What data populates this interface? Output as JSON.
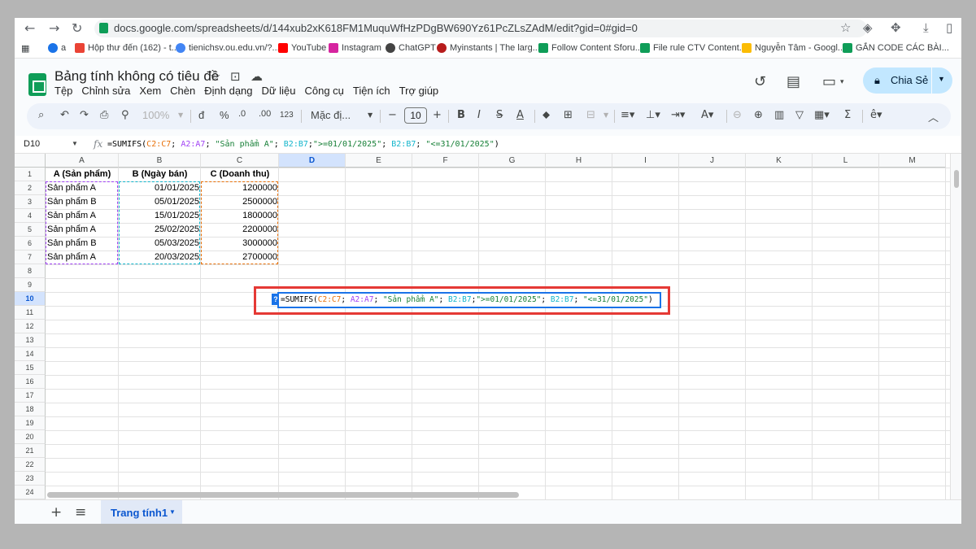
{
  "browser": {
    "url": "docs.google.com/spreadsheets/d/144xub2xK618FM1MuquWfHzPDgBW690Yz61PcZLsZAdM/edit?gid=0#gid=0",
    "bookmarks": [
      {
        "label": "a",
        "color": "#1a73e8"
      },
      {
        "label": "Hộp thư đến (162) - t...",
        "color": "#ea4335"
      },
      {
        "label": "tienichsv.ou.edu.vn/?...",
        "color": "#4285f4"
      },
      {
        "label": "YouTube",
        "color": "#ff0000"
      },
      {
        "label": "Instagram",
        "color": "#d6249f"
      },
      {
        "label": "ChatGPT",
        "color": "#444444"
      },
      {
        "label": "Myinstants | The larg...",
        "color": "#b71c1c"
      },
      {
        "label": "Follow Content Sforu...",
        "color": "#0f9d58"
      },
      {
        "label": "File rule CTV Content...",
        "color": "#0f9d58"
      },
      {
        "label": "Nguyễn Tâm - Googl...",
        "color": "#fbbc04"
      },
      {
        "label": "GẮN CODE CÁC BÀI...",
        "color": "#0f9d58"
      }
    ]
  },
  "doc": {
    "title": "Bảng tính không có tiêu đề",
    "menu": [
      "Tệp",
      "Chỉnh sửa",
      "Xem",
      "Chèn",
      "Định dạng",
      "Dữ liệu",
      "Công cụ",
      "Tiện ích",
      "Trợ giúp"
    ],
    "share_label": "Chia Sẻ"
  },
  "toolbar": {
    "zoom": "100%",
    "currency": "đ",
    "percent": "%",
    "dec_decrease": ".0",
    "dec_increase": ".00",
    "number_format": "123",
    "font": "Mặc đị...",
    "font_size": "10"
  },
  "formula_bar": {
    "cell_ref": "D10",
    "formula_parts": [
      {
        "text": "=SUMIFS(",
        "color": "#000000"
      },
      {
        "text": "C2:C7",
        "color": "#e8710a"
      },
      {
        "text": "; ",
        "color": "#000000"
      },
      {
        "text": "A2:A7",
        "color": "#a142f4"
      },
      {
        "text": "; ",
        "color": "#000000"
      },
      {
        "text": "\"Sản phẩm A\"",
        "color": "#188038"
      },
      {
        "text": "; ",
        "color": "#000000"
      },
      {
        "text": "B2:B7",
        "color": "#12b5cb"
      },
      {
        "text": ";",
        "color": "#000000"
      },
      {
        "text": "\">=01/01/2025\"",
        "color": "#188038"
      },
      {
        "text": "; ",
        "color": "#000000"
      },
      {
        "text": "B2:B7",
        "color": "#12b5cb"
      },
      {
        "text": "; ",
        "color": "#000000"
      },
      {
        "text": "\"<=31/01/2025\"",
        "color": "#188038"
      },
      {
        "text": ")",
        "color": "#000000"
      }
    ]
  },
  "grid": {
    "columns": [
      "A",
      "B",
      "C",
      "D",
      "E",
      "F",
      "G",
      "H",
      "I",
      "J",
      "K",
      "L",
      "M"
    ],
    "selected_column": "D",
    "rows": [
      "1",
      "2",
      "3",
      "4",
      "5",
      "6",
      "7",
      "8",
      "9",
      "10",
      "11",
      "12",
      "13",
      "14",
      "15",
      "16",
      "17",
      "18",
      "19",
      "20",
      "21",
      "22",
      "23",
      "24"
    ],
    "selected_row": "10",
    "headers": [
      "A (Sản phẩm)",
      "B (Ngày bán)",
      "C (Doanh thu)"
    ],
    "data": [
      [
        "Sản phẩm A",
        "01/01/2025",
        "1200000"
      ],
      [
        "Sản phẩm B",
        "05/01/2025",
        "2500000"
      ],
      [
        "Sản phẩm A",
        "15/01/2025",
        "1800000"
      ],
      [
        "Sản phẩm A",
        "25/02/2025",
        "2200000"
      ],
      [
        "Sản phẩm B",
        "05/03/2025",
        "3000000"
      ],
      [
        "Sản phẩm A",
        "20/03/2025",
        "2700000"
      ]
    ],
    "edit_hint": "?",
    "range_colors": {
      "A": "#a142f4",
      "B": "#12b5cb",
      "C": "#e8710a",
      "highlight": "#e53935"
    }
  },
  "sheets": {
    "active": "Trang tính1"
  }
}
